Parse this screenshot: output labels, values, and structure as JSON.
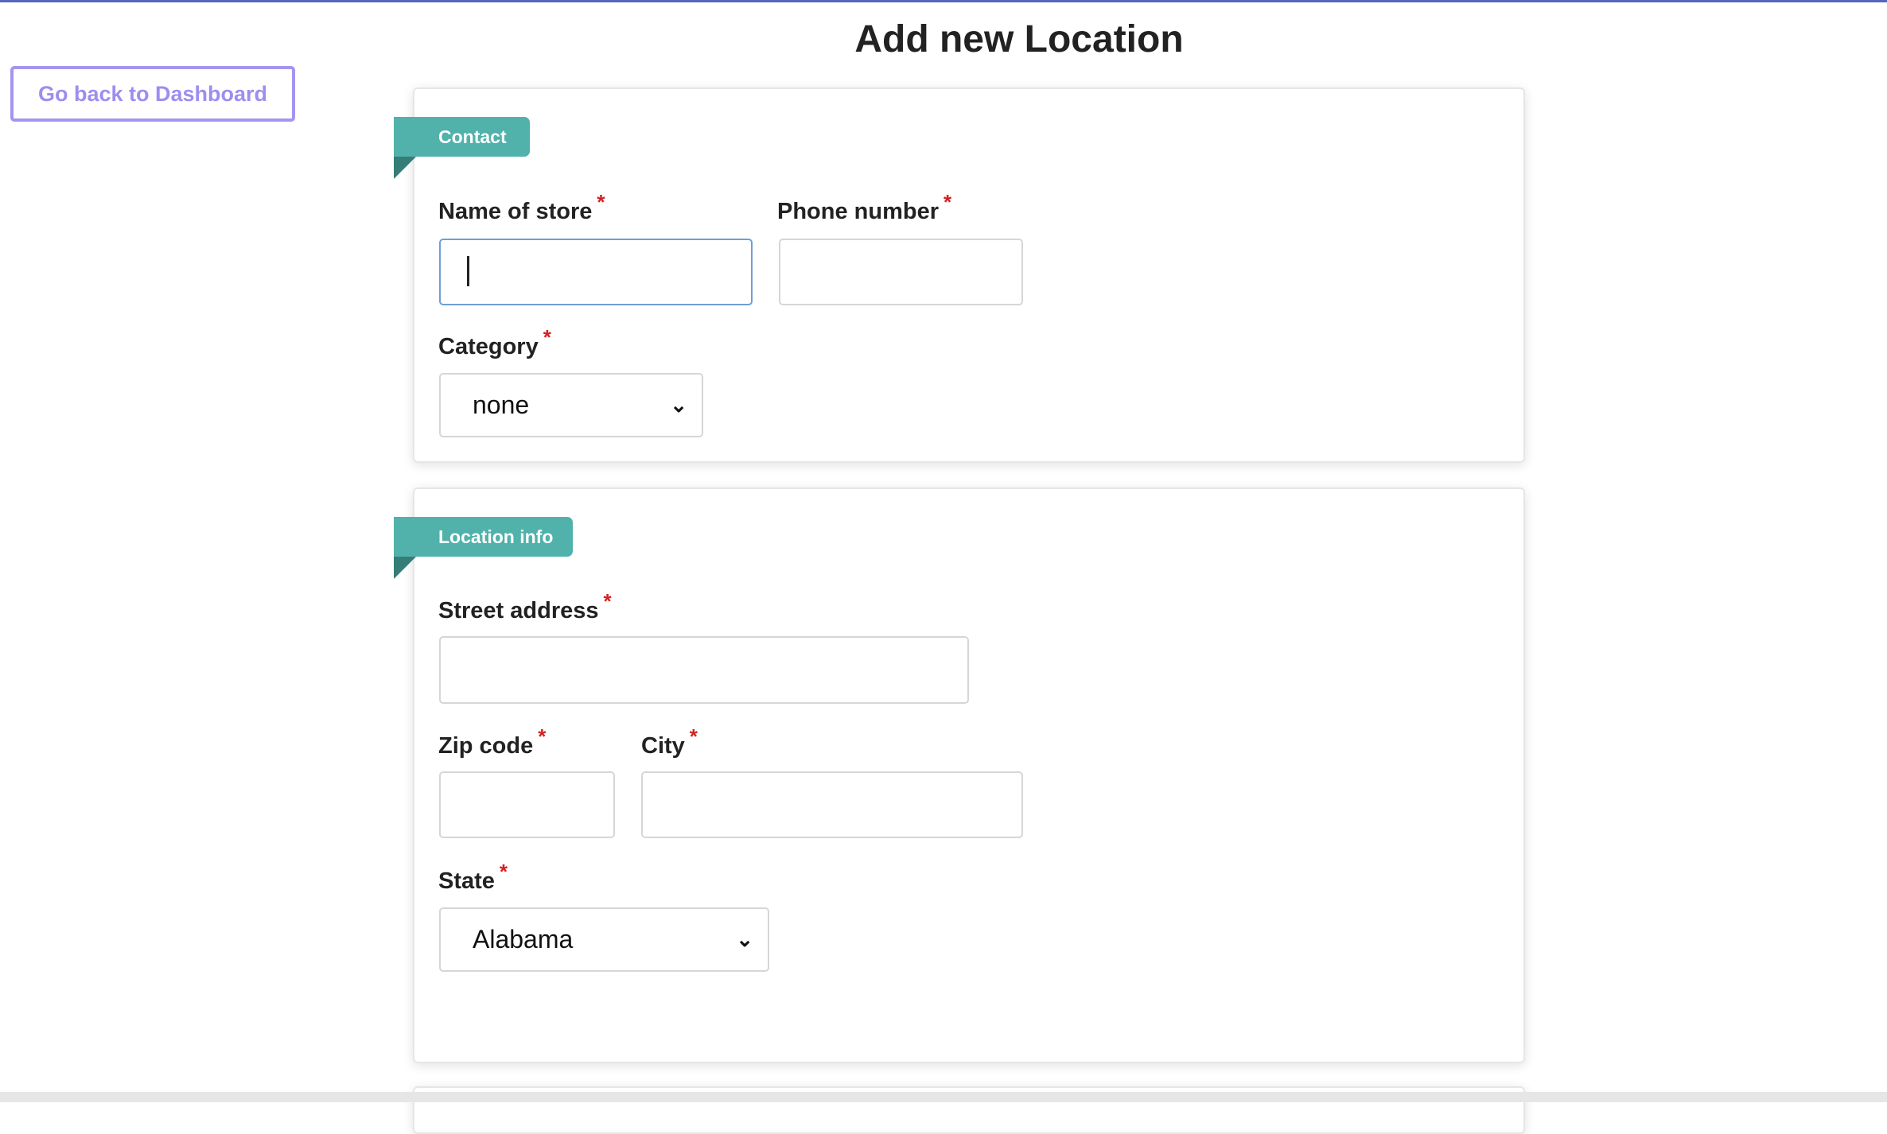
{
  "page": {
    "title": "Add new Location",
    "back_button": "Go back to Dashboard",
    "accent_color": "#50b2ab"
  },
  "contact": {
    "section_label": "Contact",
    "name_label": "Name of store",
    "name_value": "",
    "phone_label": "Phone number",
    "phone_value": "",
    "category_label": "Category",
    "category_value": "none",
    "required_mark": "*"
  },
  "location": {
    "section_label": "Location info",
    "street_label": "Street address",
    "street_value": "",
    "zip_label": "Zip code",
    "zip_value": "",
    "city_label": "City",
    "city_value": "",
    "state_label": "State",
    "state_value": "Alabama",
    "required_mark": "*"
  },
  "icons": {
    "select_arrow": "chevron-down-icon"
  }
}
